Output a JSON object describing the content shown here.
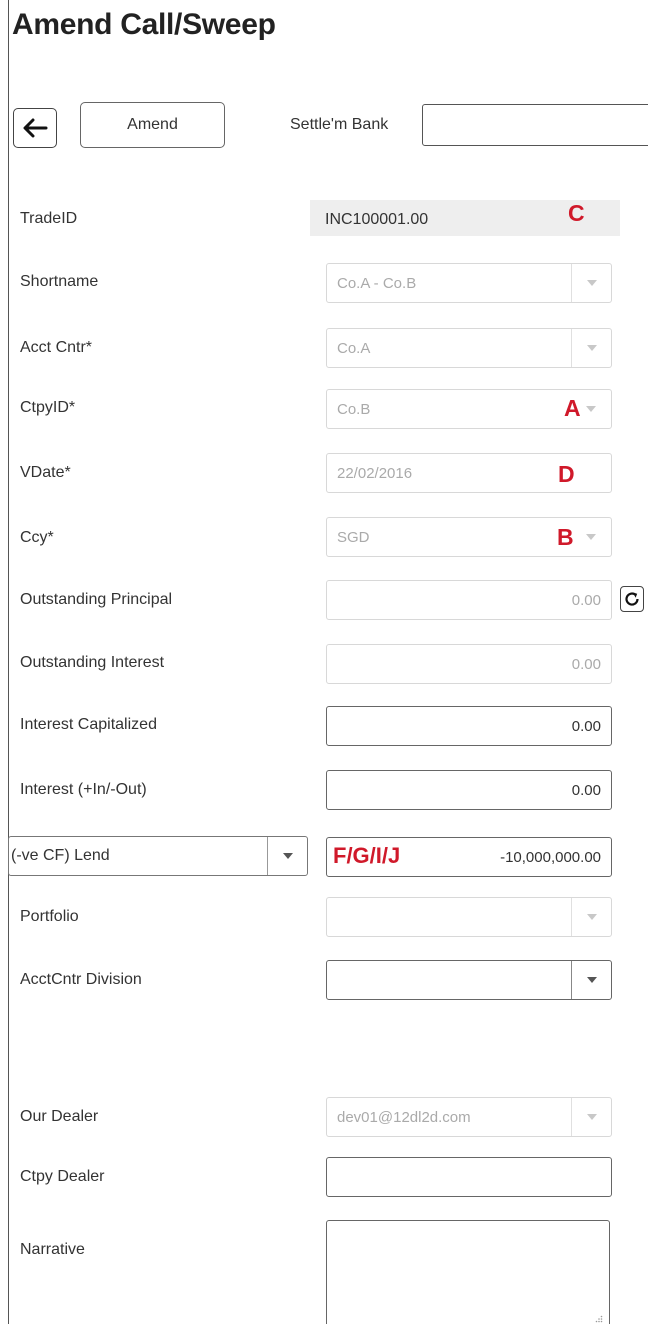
{
  "page": {
    "title": "Amend Call/Sweep"
  },
  "toolbar": {
    "back_icon": "arrow-left-icon",
    "amend_label": "Amend",
    "settle_bank_label": "Settle'm Bank",
    "settle_bank_value": ""
  },
  "form": {
    "trade_id": {
      "label": "TradeID",
      "value": "INC100001.00"
    },
    "shortname": {
      "label": "Shortname",
      "value": "Co.A - Co.B"
    },
    "acct_cntr": {
      "label": "Acct Cntr*",
      "value": "Co.A"
    },
    "ctpy_id": {
      "label": "CtpyID*",
      "value": "Co.B"
    },
    "vdate": {
      "label": "VDate*",
      "value": "22/02/2016"
    },
    "ccy": {
      "label": "Ccy*",
      "value": "SGD"
    },
    "outstanding_principal": {
      "label": "Outstanding Principal",
      "value": "0.00",
      "refresh_icon": "refresh-icon"
    },
    "outstanding_interest": {
      "label": "Outstanding Interest",
      "value": "0.00"
    },
    "interest_capitalized": {
      "label": "Interest Capitalized",
      "value": "0.00"
    },
    "interest_in_out": {
      "label": "Interest (+In/-Out)",
      "value": "0.00"
    },
    "cash_flow": {
      "selected": "(-ve CF) Lend",
      "value": "-10,000,000.00"
    },
    "portfolio": {
      "label": "Portfolio",
      "value": ""
    },
    "acctcntr_division": {
      "label": "AcctCntr Division",
      "value": ""
    },
    "our_dealer": {
      "label": "Our Dealer",
      "value": "dev01@12dl2d.com"
    },
    "ctpy_dealer": {
      "label": "Ctpy Dealer",
      "value": ""
    },
    "narrative": {
      "label": "Narrative",
      "value": ""
    }
  },
  "annotations": {
    "a": "A",
    "b": "B",
    "c": "C",
    "d": "D",
    "fgij": "F/G/I/J",
    "color": "#d0192a"
  }
}
